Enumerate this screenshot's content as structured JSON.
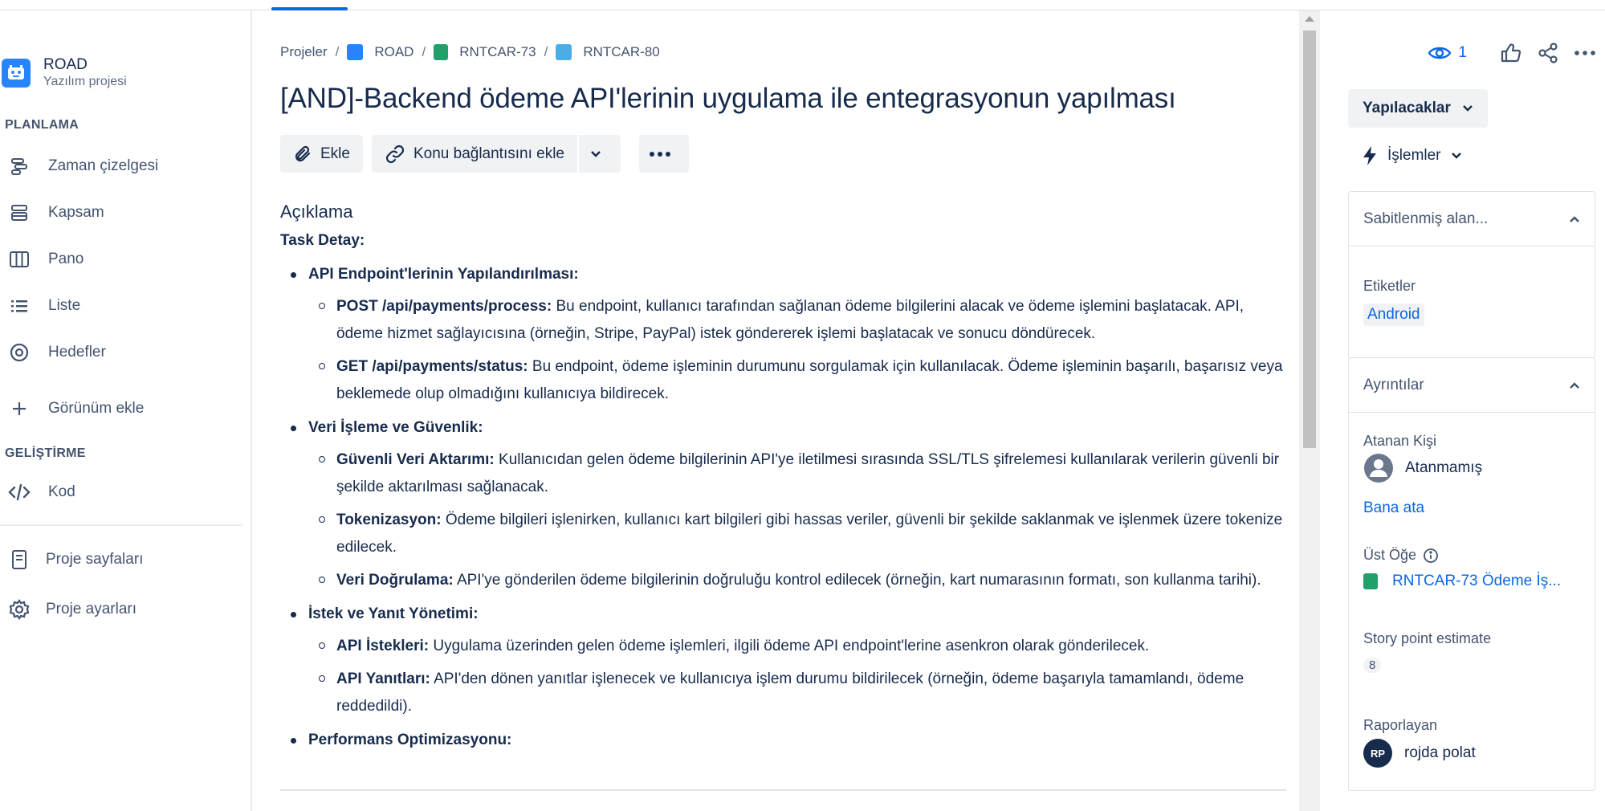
{
  "project": {
    "name": "ROAD",
    "type": "Yazılım projesi"
  },
  "sidebar": {
    "section_planning": "PLANLAMA",
    "section_dev": "GELİŞTİRME",
    "items": [
      {
        "label": "Zaman çizelgesi",
        "icon": "timeline-icon"
      },
      {
        "label": "Kapsam",
        "icon": "backlog-icon"
      },
      {
        "label": "Pano",
        "icon": "board-icon"
      },
      {
        "label": "Liste",
        "icon": "list-icon"
      },
      {
        "label": "Hedefler",
        "icon": "goals-icon"
      },
      {
        "label": "Görünüm ekle",
        "icon": "plus-icon"
      }
    ],
    "dev_items": [
      {
        "label": "Kod",
        "icon": "code-icon"
      }
    ],
    "bottom_items": [
      {
        "label": "Proje sayfaları",
        "icon": "page-icon"
      },
      {
        "label": "Proje ayarları",
        "icon": "gear-icon"
      }
    ]
  },
  "breadcrumb": {
    "items": [
      "Projeler",
      "ROAD",
      "RNTCAR-73",
      "RNTCAR-80"
    ],
    "separator": "/"
  },
  "issue": {
    "title": "[AND]-Backend ödeme API'lerinin uygulama ile entegrasyonun yapılması",
    "attach_label": "Ekle",
    "link_label": "Konu bağlantısını ekle",
    "description_heading": "Açıklama",
    "task_heading": "Task Detay:",
    "sections": [
      {
        "label": "API Endpoint'lerinin Yapılandırılması:",
        "items": [
          {
            "b": "POST /api/payments/process:",
            "t": " Bu endpoint, kullanıcı tarafından sağlanan ödeme bilgilerini alacak ve ödeme işlemini başlatacak. API, ödeme hizmet sağlayıcısına (örneğin, Stripe, PayPal) istek göndererek işlemi başlatacak ve sonucu döndürecek."
          },
          {
            "b": "GET /api/payments/status:",
            "t": " Bu endpoint, ödeme işleminin durumunu sorgulamak için kullanılacak. Ödeme işleminin başarılı, başarısız veya beklemede olup olmadığını kullanıcıya bildirecek."
          }
        ]
      },
      {
        "label": "Veri İşleme ve Güvenlik:",
        "items": [
          {
            "b": "Güvenli Veri Aktarımı:",
            "t": " Kullanıcıdan gelen ödeme bilgilerinin API'ye iletilmesi sırasında SSL/TLS şifrelemesi kullanılarak verilerin güvenli bir şekilde aktarılması sağlanacak."
          },
          {
            "b": "Tokenizasyon:",
            "t": " Ödeme bilgileri işlenirken, kullanıcı kart bilgileri gibi hassas veriler, güvenli bir şekilde saklanmak ve işlenmek üzere tokenize edilecek."
          },
          {
            "b": "Veri Doğrulama:",
            "t": " API'ye gönderilen ödeme bilgilerinin doğruluğu kontrol edilecek (örneğin, kart numarasının formatı, son kullanma tarihi)."
          }
        ]
      },
      {
        "label": "İstek ve Yanıt Yönetimi:",
        "items": [
          {
            "b": "API İstekleri:",
            "t": " Uygulama üzerinden gelen ödeme işlemleri, ilgili ödeme API endpoint'lerine asenkron olarak gönderilecek."
          },
          {
            "b": "API Yanıtları:",
            "t": " API'den dönen yanıtlar işlenecek ve kullanıcıya işlem durumu bildirilecek (örneğin, ödeme başarıyla tamamlandı, ödeme reddedildi)."
          }
        ]
      },
      {
        "label": "Performans Optimizasyonu:",
        "items": []
      }
    ]
  },
  "right": {
    "watchers": "1",
    "status": "Yapılacaklar",
    "actions": "İşlemler",
    "pinned_title": "Sabitlenmiş alan...",
    "labels_label": "Etiketler",
    "label_value": "Android",
    "details_title": "Ayrıntılar",
    "assignee_label": "Atanan Kişi",
    "assignee_value": "Atanmamış",
    "assign_me": "Bana ata",
    "parent_label": "Üst Öğe",
    "parent_value": "RNTCAR-73 Ödeme İş...",
    "story_label": "Story point estimate",
    "story_value": "8",
    "reporter_label": "Raporlayan",
    "reporter_initials": "RP",
    "reporter_name": "rojda polat"
  },
  "colors": {
    "accent": "#0c66e4",
    "story_green": "#22a06b",
    "subtask_blue": "#4bade8"
  }
}
